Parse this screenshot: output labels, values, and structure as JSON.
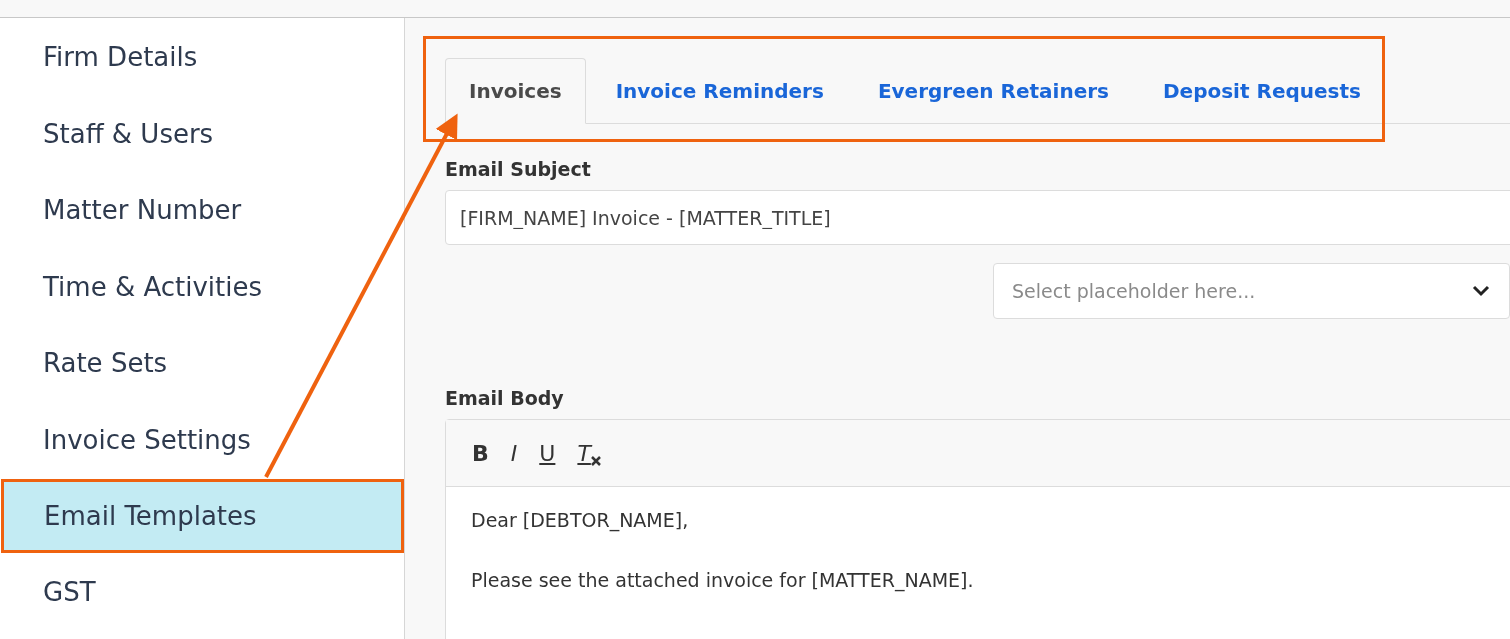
{
  "sidebar": {
    "items": [
      {
        "label": "Firm Details",
        "selected": false,
        "annotated": false
      },
      {
        "label": "Staff & Users",
        "selected": false,
        "annotated": false
      },
      {
        "label": "Matter Number",
        "selected": false,
        "annotated": false
      },
      {
        "label": "Time & Activities",
        "selected": false,
        "annotated": false
      },
      {
        "label": "Rate Sets",
        "selected": false,
        "annotated": false
      },
      {
        "label": "Invoice Settings",
        "selected": false,
        "annotated": false
      },
      {
        "label": "Email Templates",
        "selected": true,
        "annotated": true
      },
      {
        "label": "GST",
        "selected": false,
        "annotated": false
      }
    ]
  },
  "tabs": {
    "annotated": true,
    "items": [
      {
        "label": "Invoices",
        "selected": true
      },
      {
        "label": "Invoice Reminders",
        "selected": false
      },
      {
        "label": "Evergreen Retainers",
        "selected": false
      },
      {
        "label": "Deposit Requests",
        "selected": false
      }
    ]
  },
  "email_subject": {
    "label": "Email Subject",
    "value": "[FIRM_NAME] Invoice - [MATTER_TITLE]"
  },
  "placeholder_select": {
    "placeholder": "Select placeholder here..."
  },
  "email_body": {
    "label": "Email Body",
    "toolbar": [
      {
        "kind": "bold",
        "label": "B"
      },
      {
        "kind": "italic",
        "label": "I"
      },
      {
        "kind": "underline",
        "label": "U"
      },
      {
        "kind": "clear",
        "label": "T"
      }
    ],
    "lines": [
      "Dear [DEBTOR_NAME],",
      "Please see the attached invoice for [MATTER_NAME]."
    ]
  }
}
